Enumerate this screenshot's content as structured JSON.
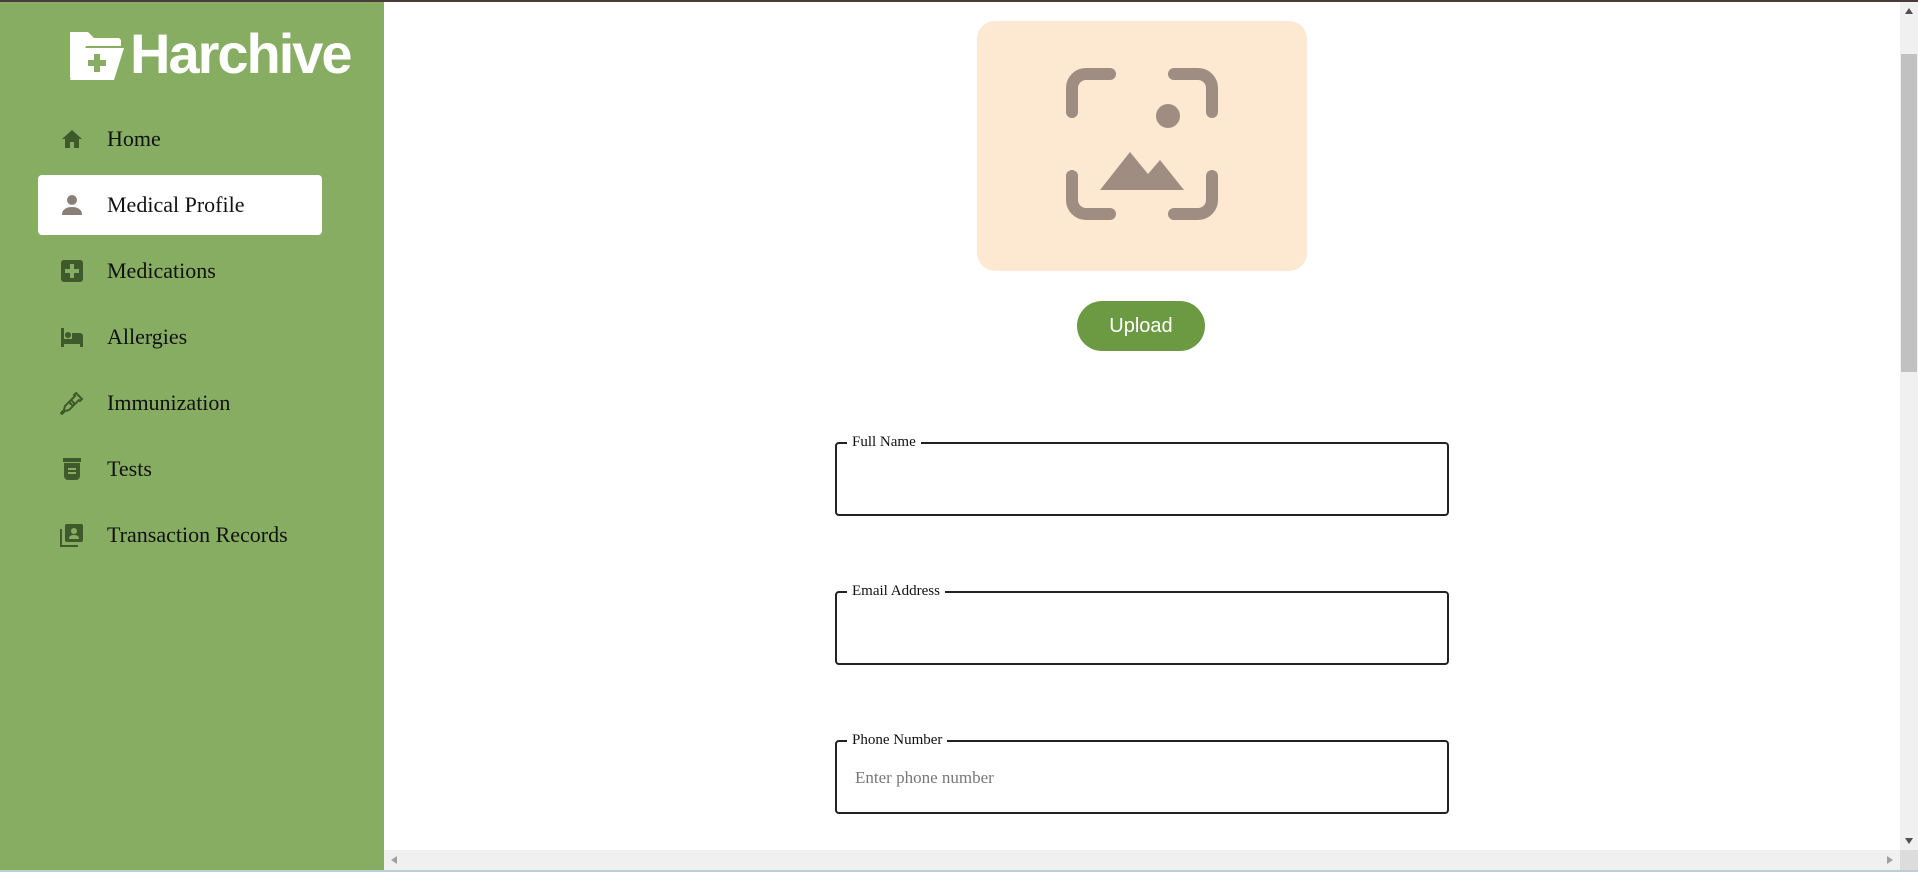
{
  "app": {
    "name": "Harchive",
    "brand_color": "#87ad63",
    "accent_color": "#6c9a42"
  },
  "sidebar": {
    "items": [
      {
        "label": "Home",
        "icon": "home-icon",
        "active": false
      },
      {
        "label": "Medical Profile",
        "icon": "person-icon",
        "active": true
      },
      {
        "label": "Medications",
        "icon": "medical-plus-icon",
        "active": false
      },
      {
        "label": "Allergies",
        "icon": "bed-icon",
        "active": false
      },
      {
        "label": "Immunization",
        "icon": "syringe-icon",
        "active": false
      },
      {
        "label": "Tests",
        "icon": "test-jar-icon",
        "active": false
      },
      {
        "label": "Transaction Records",
        "icon": "receipt-icon",
        "active": false
      }
    ]
  },
  "profile": {
    "photo_placeholder_icon": "image-placeholder-icon",
    "upload_label": "Upload"
  },
  "form": {
    "full_name": {
      "label": "Full Name",
      "value": "",
      "placeholder": ""
    },
    "email": {
      "label": "Email Address",
      "value": "",
      "placeholder": ""
    },
    "phone": {
      "label": "Phone Number",
      "value": "",
      "placeholder": "Enter phone number"
    }
  }
}
